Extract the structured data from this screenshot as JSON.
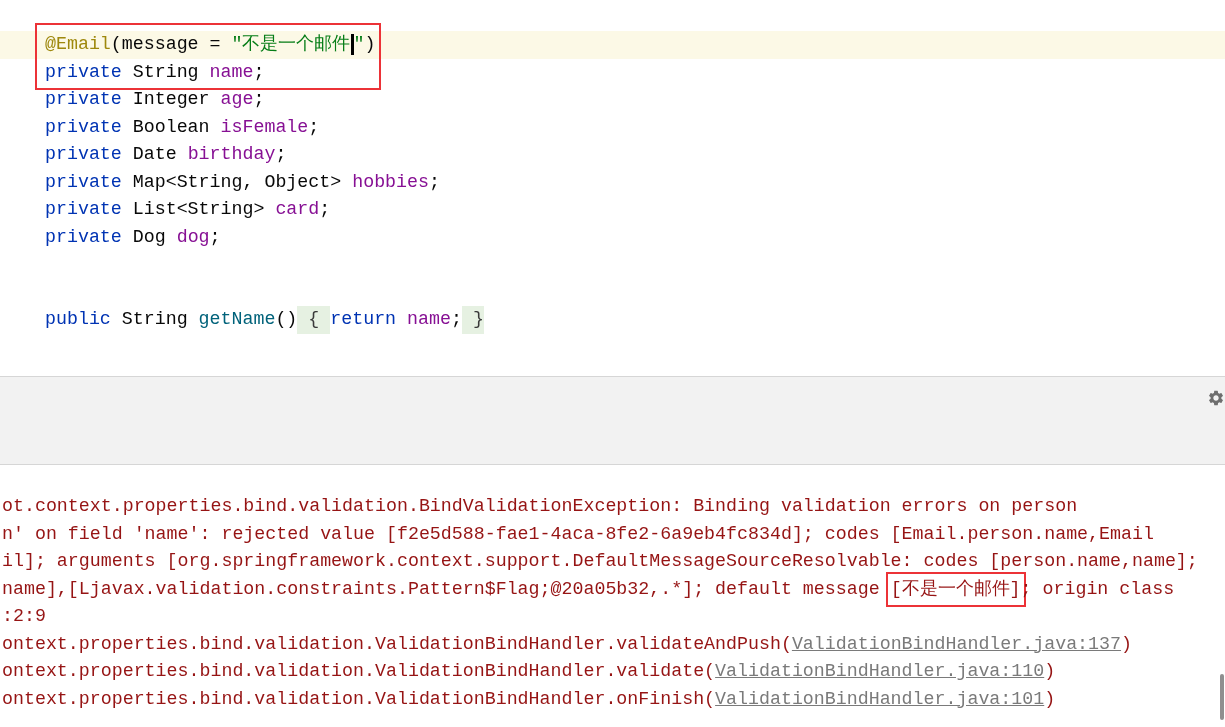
{
  "editor": {
    "lines": [
      {
        "kind": "code",
        "current": true,
        "marked": true,
        "tokens": [
          {
            "kind": "annotation",
            "text": "@Email"
          },
          {
            "kind": "plain",
            "text": "(message = "
          },
          {
            "kind": "string",
            "text": "\"不是一个邮件"
          },
          {
            "kind": "caret"
          },
          {
            "kind": "string",
            "text": "\""
          },
          {
            "kind": "plain",
            "text": ")"
          }
        ]
      },
      {
        "kind": "code",
        "current": false,
        "marked": true,
        "tokens": [
          {
            "kind": "keyword",
            "text": "private"
          },
          {
            "kind": "plain",
            "text": " String "
          },
          {
            "kind": "field",
            "text": "name"
          },
          {
            "kind": "plain",
            "text": ";"
          }
        ]
      },
      {
        "kind": "code",
        "current": false,
        "marked": false,
        "tokens": [
          {
            "kind": "keyword",
            "text": "private"
          },
          {
            "kind": "plain",
            "text": " Integer "
          },
          {
            "kind": "field",
            "text": "age"
          },
          {
            "kind": "plain",
            "text": ";"
          }
        ]
      },
      {
        "kind": "code",
        "current": false,
        "marked": false,
        "tokens": [
          {
            "kind": "keyword",
            "text": "private"
          },
          {
            "kind": "plain",
            "text": " Boolean "
          },
          {
            "kind": "field",
            "text": "isFemale"
          },
          {
            "kind": "plain",
            "text": ";"
          }
        ]
      },
      {
        "kind": "code",
        "current": false,
        "marked": false,
        "tokens": [
          {
            "kind": "keyword",
            "text": "private"
          },
          {
            "kind": "plain",
            "text": " Date "
          },
          {
            "kind": "field",
            "text": "birthday"
          },
          {
            "kind": "plain",
            "text": ";"
          }
        ]
      },
      {
        "kind": "code",
        "current": false,
        "marked": false,
        "tokens": [
          {
            "kind": "keyword",
            "text": "private"
          },
          {
            "kind": "plain",
            "text": " Map<String, Object> "
          },
          {
            "kind": "field",
            "text": "hobbies"
          },
          {
            "kind": "plain",
            "text": ";"
          }
        ]
      },
      {
        "kind": "code",
        "current": false,
        "marked": false,
        "tokens": [
          {
            "kind": "keyword",
            "text": "private"
          },
          {
            "kind": "plain",
            "text": " List<String> "
          },
          {
            "kind": "field",
            "text": "card"
          },
          {
            "kind": "plain",
            "text": ";"
          }
        ]
      },
      {
        "kind": "code",
        "current": false,
        "marked": false,
        "tokens": [
          {
            "kind": "keyword",
            "text": "private"
          },
          {
            "kind": "plain",
            "text": " Dog "
          },
          {
            "kind": "field",
            "text": "dog"
          },
          {
            "kind": "plain",
            "text": ";"
          }
        ]
      },
      {
        "kind": "blank"
      },
      {
        "kind": "blank"
      },
      {
        "kind": "code",
        "current": false,
        "marked": false,
        "tokens": [
          {
            "kind": "keyword",
            "text": "public"
          },
          {
            "kind": "plain",
            "text": " String "
          },
          {
            "kind": "method",
            "text": "getName"
          },
          {
            "kind": "plain",
            "text": "()"
          },
          {
            "kind": "fold",
            "text": " { "
          },
          {
            "kind": "keyword",
            "text": "return "
          },
          {
            "kind": "field",
            "text": "name"
          },
          {
            "kind": "plain",
            "text": ";"
          },
          {
            "kind": "fold",
            "text": " }"
          }
        ]
      }
    ]
  },
  "console": {
    "lines": [
      {
        "segments": [
          {
            "kind": "plain",
            "text": "ot.context.properties.bind.validation.BindValidationException: Binding validation errors on person"
          }
        ]
      },
      {
        "segments": [
          {
            "kind": "plain",
            "text": "n' on field 'name': rejected value [f2e5d588-fae1-4aca-8fe2-6a9eb4fc834d]; codes [Email.person.name,Email"
          }
        ]
      },
      {
        "segments": [
          {
            "kind": "plain",
            "text": "il]; arguments [org.springframework.context.support.DefaultMessageSourceResolvable: codes [person.name,name];"
          }
        ]
      },
      {
        "segments": [
          {
            "kind": "plain",
            "text": "name],[Ljavax.validation.constraints.Pattern$Flag;@20a05b32,.*]; default message "
          },
          {
            "kind": "marked",
            "text": "[不是一个邮件]"
          },
          {
            "kind": "plain",
            "text": "; origin class"
          }
        ]
      },
      {
        "segments": [
          {
            "kind": "plain",
            "text": ":2:9"
          }
        ]
      },
      {
        "segments": [
          {
            "kind": "plain",
            "text": "ontext.properties.bind.validation.ValidationBindHandler.validateAndPush("
          },
          {
            "kind": "link",
            "text": "ValidationBindHandler.java:137"
          },
          {
            "kind": "plain",
            "text": ")"
          }
        ]
      },
      {
        "segments": [
          {
            "kind": "plain",
            "text": "ontext.properties.bind.validation.ValidationBindHandler.validate("
          },
          {
            "kind": "link",
            "text": "ValidationBindHandler.java:110"
          },
          {
            "kind": "plain",
            "text": ")"
          }
        ]
      },
      {
        "segments": [
          {
            "kind": "plain",
            "text": "ontext.properties.bind.validation.ValidationBindHandler.onFinish("
          },
          {
            "kind": "link",
            "text": "ValidationBindHandler.java:101"
          },
          {
            "kind": "plain",
            "text": ")"
          }
        ]
      }
    ]
  }
}
